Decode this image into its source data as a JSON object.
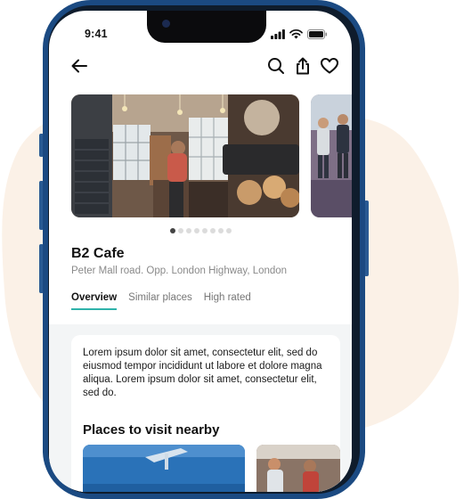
{
  "status_bar": {
    "time": "9:41"
  },
  "place": {
    "name": "B2 Cafe",
    "address": "Peter Mall road. Opp. London Highway, London"
  },
  "tabs": [
    {
      "label": "Overview",
      "active": true
    },
    {
      "label": "Similar places",
      "active": false
    },
    {
      "label": "High rated",
      "active": false
    }
  ],
  "description": "Lorem ipsum dolor sit amet, consectetur elit, sed do eiusmod tempor incididunt ut labore et dolore magna aliqua. Lorem ipsum dolor sit amet, consectetur elit, sed do.",
  "nearby": {
    "title": "Places to visit nearby"
  },
  "gallery": {
    "active_index": 0,
    "dot_count": 8
  },
  "colors": {
    "accent": "#2fb2aa",
    "phone_frame": "#1b4a82",
    "background_blob": "#fbf1e7",
    "content_bg": "#f3f5f6"
  },
  "icons": {
    "back": "arrow-left-icon",
    "search": "search-icon",
    "share": "share-icon",
    "favorite": "heart-icon",
    "signal": "signal-icon",
    "wifi": "wifi-icon",
    "battery": "battery-icon"
  }
}
